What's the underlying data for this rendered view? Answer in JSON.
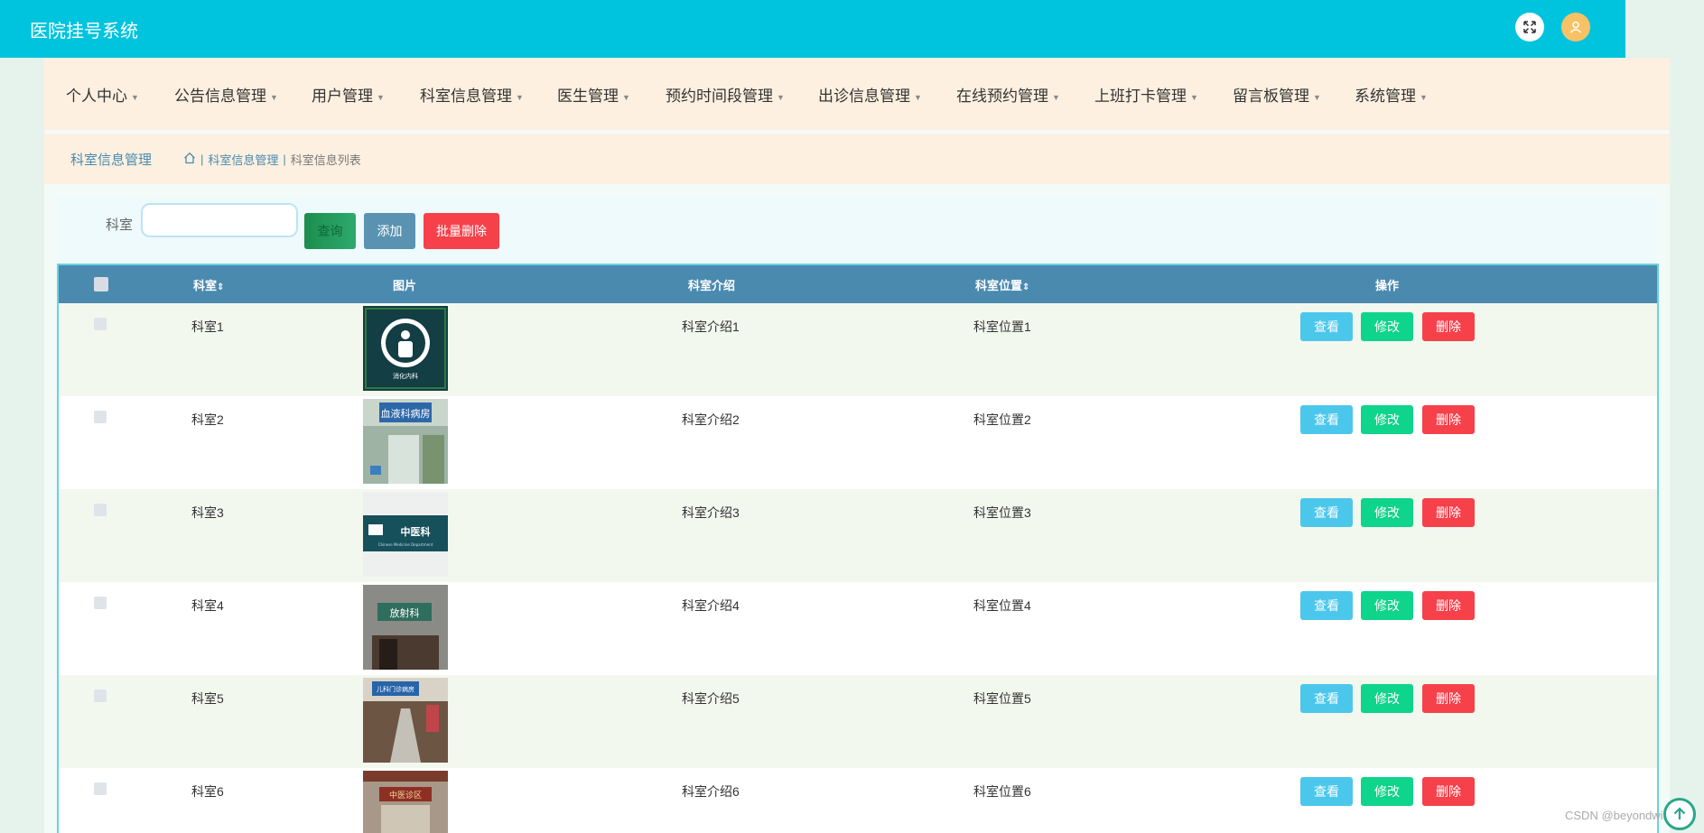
{
  "app": {
    "title": "医院挂号系统"
  },
  "header": {
    "fullscreen_icon": "expand-icon",
    "user_icon": "user-icon"
  },
  "nav": {
    "items": [
      {
        "label": "个人中心"
      },
      {
        "label": "公告信息管理"
      },
      {
        "label": "用户管理"
      },
      {
        "label": "科室信息管理"
      },
      {
        "label": "医生管理"
      },
      {
        "label": "预约时间段管理"
      },
      {
        "label": "出诊信息管理"
      },
      {
        "label": "在线预约管理"
      },
      {
        "label": "上班打卡管理"
      },
      {
        "label": "留言板管理"
      },
      {
        "label": "系统管理"
      }
    ]
  },
  "breadcrumb": {
    "title": "科室信息管理",
    "home_icon": "home-icon",
    "sep": "|",
    "level1": "科室信息管理",
    "level2": "科室信息列表"
  },
  "search": {
    "label": "科室",
    "value": "",
    "placeholder": "",
    "query_label": "查询",
    "add_label": "添加",
    "batch_delete_label": "批量删除"
  },
  "table": {
    "headers": {
      "dept": "科室",
      "image": "图片",
      "intro": "科室介绍",
      "location": "科室位置",
      "actions": "操作"
    },
    "sort_icon": "sort-icon",
    "view_label": "查看",
    "edit_label": "修改",
    "delete_label": "删除",
    "rows": [
      {
        "dept": "科室1",
        "intro": "科室介绍1",
        "location": "科室位置1"
      },
      {
        "dept": "科室2",
        "intro": "科室介绍2",
        "location": "科室位置2"
      },
      {
        "dept": "科室3",
        "intro": "科室介绍3",
        "location": "科室位置3"
      },
      {
        "dept": "科室4",
        "intro": "科室介绍4",
        "location": "科室位置4"
      },
      {
        "dept": "科室5",
        "intro": "科室介绍5",
        "location": "科室位置5"
      },
      {
        "dept": "科室6",
        "intro": "科室介绍6",
        "location": "科室位置6"
      }
    ]
  },
  "thumb_text": {
    "t1": "消化内科",
    "t2": "血液科病房",
    "t3": "中医科",
    "t3_sub": "Chinese Medicine Department",
    "t4": "放射科",
    "t5": "儿科门诊病房",
    "t6": "中医诊区"
  },
  "watermark": "CSDN @beyondwild",
  "back_to_top_icon": "arrow-up-icon"
}
